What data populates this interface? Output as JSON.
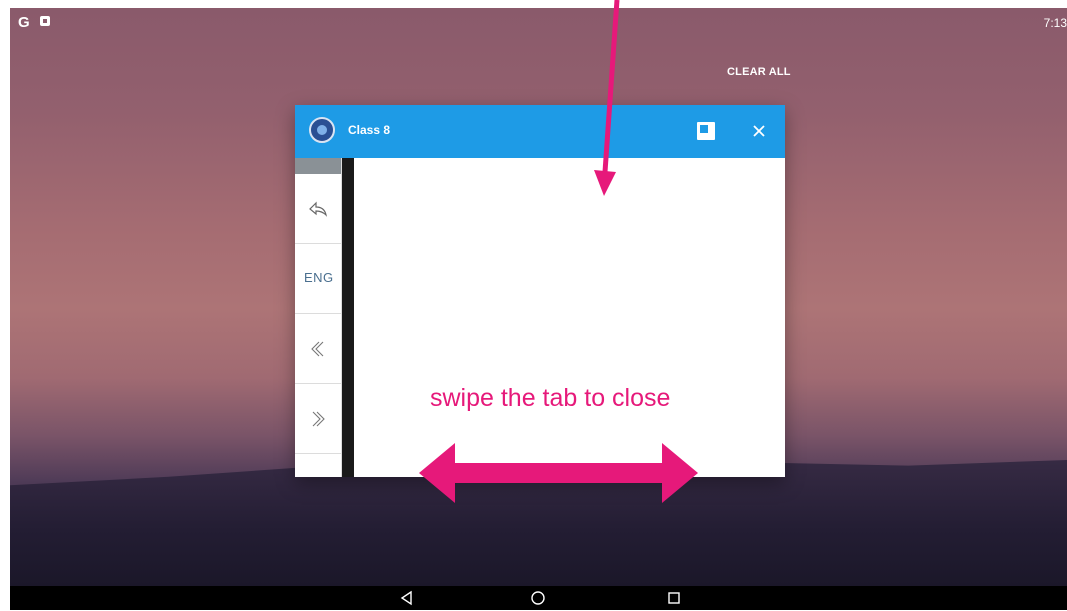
{
  "status_bar": {
    "time": "7:13",
    "g_icon": "google-g-icon",
    "notification_icon": "notification-icon"
  },
  "recents": {
    "clear_all_label": "CLEAR ALL"
  },
  "app_card": {
    "title": "Class 8",
    "header_color": "#1e9be6",
    "sidebar": [
      {
        "icon": "reply-icon"
      },
      {
        "label": "ENG"
      },
      {
        "icon": "chevron-left-icon"
      },
      {
        "icon": "chevron-right-icon"
      }
    ]
  },
  "annotation": {
    "text": "swipe the tab to close",
    "color": "#e6197a"
  },
  "nav_bar": {
    "buttons": [
      "back-icon",
      "home-icon",
      "recents-icon"
    ]
  }
}
